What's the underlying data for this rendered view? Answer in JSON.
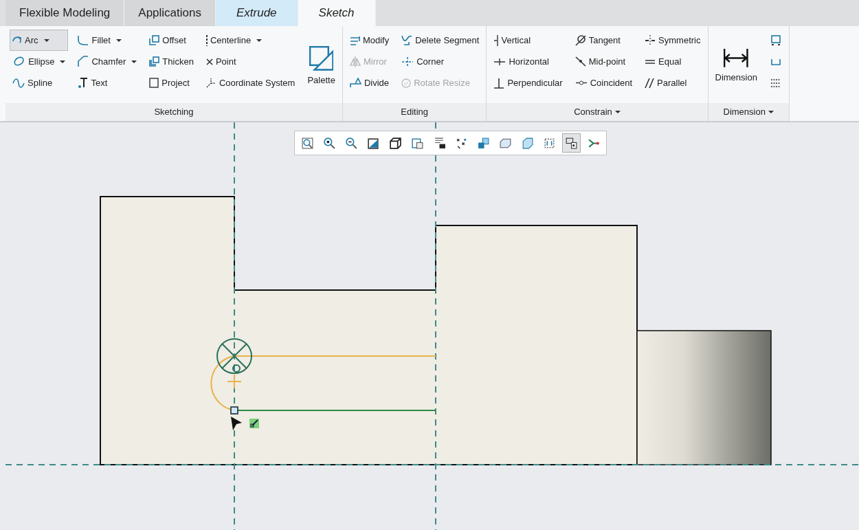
{
  "tabs": [
    {
      "label": "Flexible Modeling",
      "selected": false,
      "kind": "standard"
    },
    {
      "label": "Applications",
      "selected": false,
      "kind": "standard"
    },
    {
      "label": "Extrude",
      "selected": false,
      "kind": "contextual"
    },
    {
      "label": "Sketch",
      "selected": true,
      "kind": "contextual"
    }
  ],
  "groups": [
    {
      "title": "Sketching",
      "menu": false,
      "blocks": [
        {
          "kind": "column",
          "items": [
            {
              "label": "Arc",
              "dropdown": true,
              "selected": true,
              "disabled": false
            },
            {
              "label": "Ellipse",
              "dropdown": true,
              "selected": false,
              "disabled": false
            },
            {
              "label": "Spline",
              "dropdown": false,
              "selected": false,
              "disabled": false
            }
          ]
        },
        {
          "kind": "column",
          "items": [
            {
              "label": "Fillet",
              "dropdown": true,
              "selected": false,
              "disabled": false
            },
            {
              "label": "Chamfer",
              "dropdown": true,
              "selected": false,
              "disabled": false
            },
            {
              "label": "Text",
              "dropdown": false,
              "selected": false,
              "disabled": false
            }
          ]
        },
        {
          "kind": "column",
          "items": [
            {
              "label": "Offset",
              "dropdown": false,
              "selected": false,
              "disabled": false
            },
            {
              "label": "Thicken",
              "dropdown": false,
              "selected": false,
              "disabled": false
            },
            {
              "label": "Project",
              "dropdown": false,
              "selected": false,
              "disabled": false
            }
          ]
        },
        {
          "kind": "column",
          "items": [
            {
              "label": "Centerline",
              "dropdown": true,
              "selected": false,
              "disabled": false
            },
            {
              "label": "Point",
              "dropdown": false,
              "selected": false,
              "disabled": false
            },
            {
              "label": "Coordinate System",
              "dropdown": false,
              "selected": false,
              "disabled": false
            }
          ]
        },
        {
          "kind": "large",
          "label": "Palette"
        }
      ]
    },
    {
      "title": "Editing",
      "menu": false,
      "blocks": [
        {
          "kind": "column",
          "items": [
            {
              "label": "Modify",
              "dropdown": false,
              "selected": false,
              "disabled": false
            },
            {
              "label": "Mirror",
              "dropdown": false,
              "selected": false,
              "disabled": true
            },
            {
              "label": "Divide",
              "dropdown": false,
              "selected": false,
              "disabled": false
            }
          ]
        },
        {
          "kind": "column",
          "items": [
            {
              "label": "Delete Segment",
              "dropdown": false,
              "selected": false,
              "disabled": false
            },
            {
              "label": "Corner",
              "dropdown": false,
              "selected": false,
              "disabled": false
            },
            {
              "label": "Rotate Resize",
              "dropdown": false,
              "selected": false,
              "disabled": true
            }
          ]
        }
      ]
    },
    {
      "title": "Constrain",
      "menu": true,
      "blocks": [
        {
          "kind": "column",
          "items": [
            {
              "label": "Vertical",
              "dropdown": false,
              "selected": false,
              "disabled": false
            },
            {
              "label": "Horizontal",
              "dropdown": false,
              "selected": false,
              "disabled": false
            },
            {
              "label": "Perpendicular",
              "dropdown": false,
              "selected": false,
              "disabled": false
            }
          ]
        },
        {
          "kind": "column",
          "items": [
            {
              "label": "Tangent",
              "dropdown": false,
              "selected": false,
              "disabled": false
            },
            {
              "label": "Mid-point",
              "dropdown": false,
              "selected": false,
              "disabled": false
            },
            {
              "label": "Coincident",
              "dropdown": false,
              "selected": false,
              "disabled": false
            }
          ]
        },
        {
          "kind": "column",
          "items": [
            {
              "label": "Symmetric",
              "dropdown": false,
              "selected": false,
              "disabled": false
            },
            {
              "label": "Equal",
              "dropdown": false,
              "selected": false,
              "disabled": false
            },
            {
              "label": "Parallel",
              "dropdown": false,
              "selected": false,
              "disabled": false
            }
          ]
        }
      ]
    },
    {
      "title": "Dimension",
      "menu": true,
      "blocks": [
        {
          "kind": "large",
          "label": "Dimension"
        },
        {
          "kind": "icons",
          "items": [
            {
              "selected": false,
              "disabled": false
            },
            {
              "selected": false,
              "disabled": false
            },
            {
              "selected": false,
              "disabled": false
            }
          ]
        }
      ]
    }
  ],
  "view_toolbar": [
    {
      "selected": false
    },
    {
      "selected": false
    },
    {
      "selected": false
    },
    {
      "selected": false
    },
    {
      "selected": false
    },
    {
      "selected": false
    },
    {
      "selected": false
    },
    {
      "selected": false
    },
    {
      "selected": false
    },
    {
      "selected": false
    },
    {
      "selected": false
    },
    {
      "selected": false
    },
    {
      "selected": true
    },
    {
      "selected": false
    }
  ]
}
